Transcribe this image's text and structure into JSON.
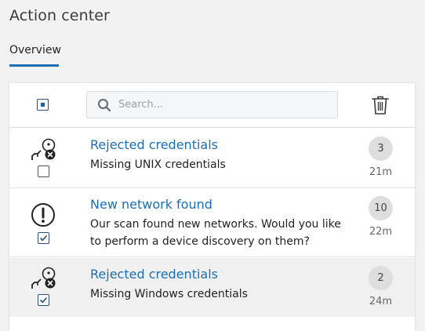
{
  "header": {
    "title": "Action center"
  },
  "tabs": [
    {
      "label": "Overview",
      "active": true
    }
  ],
  "toolbar": {
    "select_all_state": "indeterminate",
    "search_placeholder": "Search...",
    "delete_icon": "trash-icon"
  },
  "notifications": [
    {
      "title": "Rejected credentials",
      "description": "Missing UNIX credentials",
      "count": "3",
      "time": "21m",
      "icon": "rejected-credentials-icon",
      "checked": false
    },
    {
      "title": "New network found",
      "description": "Our scan found new networks. Would you like to perform a device discovery on them?",
      "count": "10",
      "time": "22m",
      "icon": "alert-circle-icon",
      "checked": true
    },
    {
      "title": "Rejected credentials",
      "description": "Missing Windows credentials",
      "count": "2",
      "time": "24m",
      "icon": "rejected-credentials-icon",
      "checked": true
    }
  ],
  "colors": {
    "accent": "#1a6fb5",
    "badge_bg": "#dedede",
    "page_bg": "#f2f2f2"
  }
}
